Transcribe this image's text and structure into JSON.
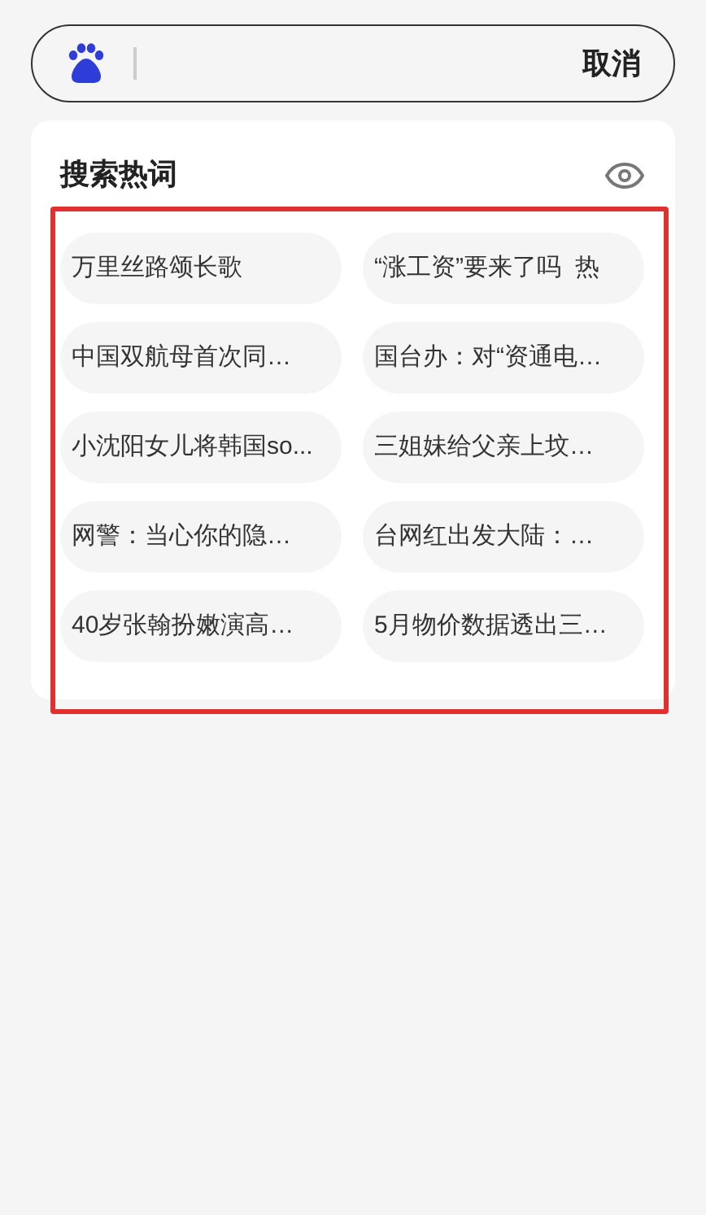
{
  "search_bar": {
    "cancel_label": "取消"
  },
  "hot_searches": {
    "title": "搜索热词",
    "items": [
      "万里丝路颂长歌",
      "“涨工资”要来了吗  热",
      "中国双航母首次同…",
      "国台办：对“资通电…",
      "小沈阳女儿将韩国so...",
      "三姐妹给父亲上坟…",
      "网警：当心你的隐…",
      "台网红出发大陆：…",
      "40岁张翰扮嫩演高…",
      "5月物价数据透出三…"
    ]
  }
}
